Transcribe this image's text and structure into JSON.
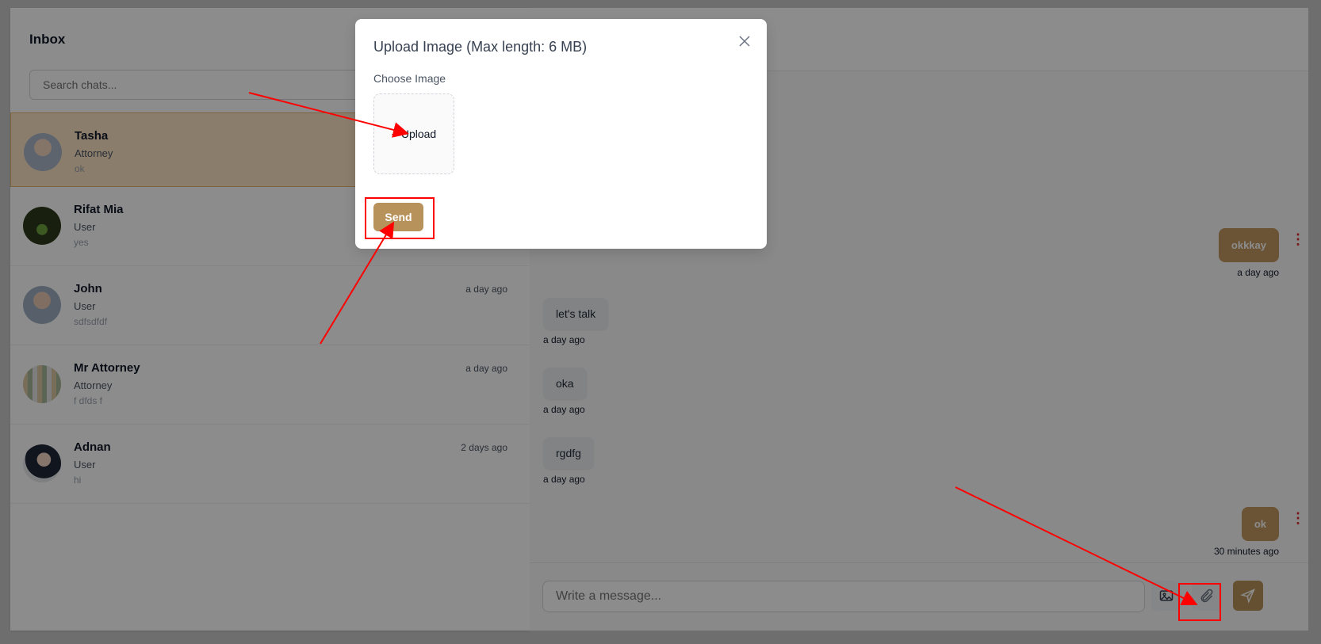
{
  "inbox": {
    "title": "Inbox",
    "search_placeholder": "Search chats...",
    "chats": [
      {
        "name": "Tasha",
        "role": "Attorney",
        "last": "ok",
        "time": ""
      },
      {
        "name": "Rifat Mia",
        "role": "User",
        "last": "yes",
        "time": ""
      },
      {
        "name": "John",
        "role": "User",
        "last": "sdfsdfdf",
        "time": "a day ago"
      },
      {
        "name": "Mr Attorney",
        "role": "Attorney",
        "last": "f dfds f",
        "time": "a day ago"
      },
      {
        "name": "Adnan",
        "role": "User",
        "last": "hi",
        "time": "2 days ago"
      }
    ]
  },
  "conversation": {
    "messages": [
      {
        "text": "okkkay",
        "time": "a day ago",
        "dir": "out"
      },
      {
        "text": "let's talk",
        "time": "a day ago",
        "dir": "in"
      },
      {
        "text": "oka",
        "time": "a day ago",
        "dir": "in"
      },
      {
        "text": "rgdfg",
        "time": "a day ago",
        "dir": "in"
      },
      {
        "text": "ok",
        "time": "30 minutes ago",
        "dir": "out"
      }
    ],
    "input_placeholder": "Write a message..."
  },
  "modal": {
    "title": "Upload Image (Max length: 6 MB)",
    "choose_label": "Choose Image",
    "upload_label": "+ Upload",
    "send_label": "Send"
  },
  "colors": {
    "accent": "#b8925b",
    "annotation": "#ff0000"
  }
}
